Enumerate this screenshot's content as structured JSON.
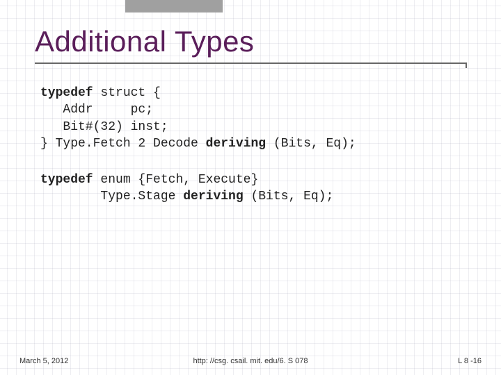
{
  "slide": {
    "title": "Additional Types"
  },
  "code": {
    "block1": {
      "l1a": "typedef",
      "l1b": " struct {",
      "l2": "   Addr     pc;",
      "l3": "   Bit#(32) inst;",
      "l4a": "} Type.Fetch 2 Decode ",
      "l4b": "deriving",
      "l4c": " (Bits, Eq);"
    },
    "block2": {
      "l1a": "typedef",
      "l1b": " enum {Fetch, Execute}",
      "l2a": "        Type.Stage ",
      "l2b": "deriving",
      "l2c": " (Bits, Eq);"
    }
  },
  "footer": {
    "date": "March 5, 2012",
    "url": "http: //csg. csail. mit. edu/6. S 078",
    "page": "L 8 -16"
  }
}
